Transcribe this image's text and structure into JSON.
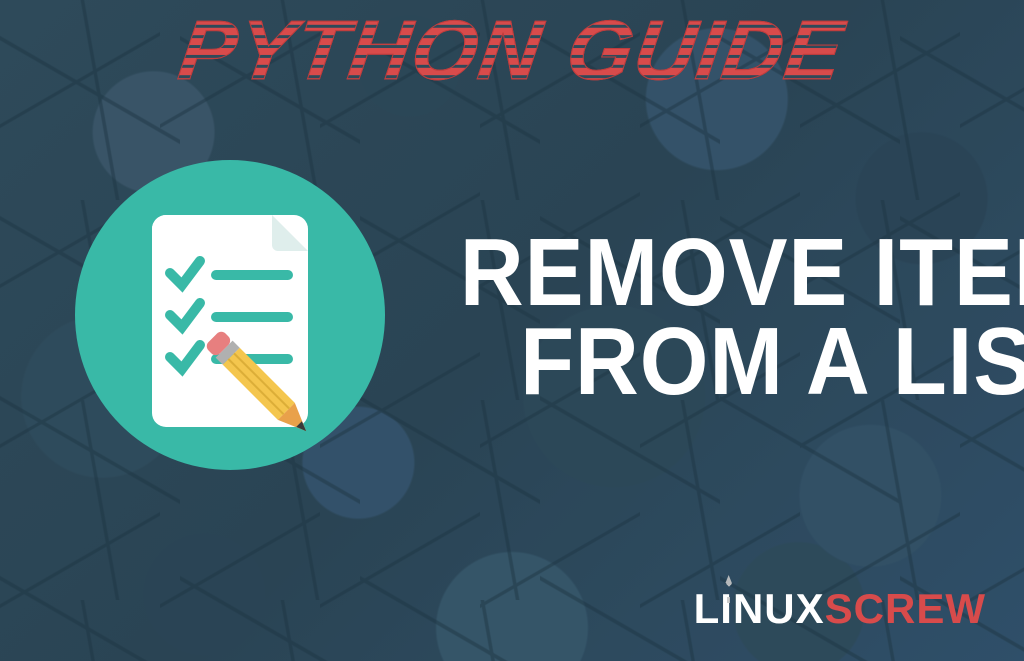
{
  "headline": "PYTHON GUIDE",
  "title": {
    "line1": "REMOVE ITEMS",
    "line2": "FROM A LIST"
  },
  "brand": {
    "part1": "LINUX",
    "part2": "SCREW"
  },
  "colors": {
    "bg": "#2e4a5a",
    "accent": "#d84b4b",
    "teal": "#39b9a7",
    "white": "#ffffff",
    "pencil_body": "#f4c64e",
    "pencil_tip": "#e9a14a",
    "pencil_lead": "#3a3a3a",
    "pencil_eraser": "#e77f7f",
    "pencil_ferrule": "#b0b0b0"
  }
}
